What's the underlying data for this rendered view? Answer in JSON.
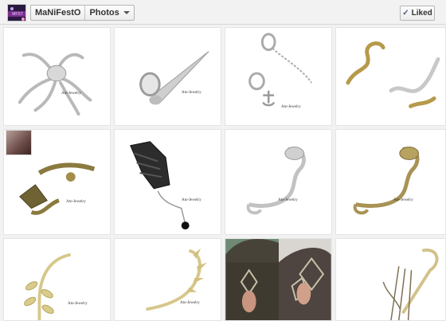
{
  "header": {
    "page_name": "MaNiFestO",
    "section_label": "Photos",
    "like_button_label": "Liked",
    "avatar_icon": "page-profile-picture"
  },
  "photos": [
    {
      "subject": "silver octopus ear cuff",
      "watermark": "Ato-Jewelry"
    },
    {
      "subject": "silver horn ear cuff",
      "watermark": "Ato-Jewelry"
    },
    {
      "subject": "silver anchor chain ear cuff",
      "watermark": "Ato-Jewelry"
    },
    {
      "subject": "gold snake ear cuffs",
      "watermark": ""
    },
    {
      "subject": "bronze dragon ear cuff",
      "watermark": "Ato-Jewelry"
    },
    {
      "subject": "black wing ear cuff with drop",
      "watermark": "Ato-Jewelry"
    },
    {
      "subject": "silver cobra ear cuff",
      "watermark": "Ato-Jewelry"
    },
    {
      "subject": "gold cobra ear cuff",
      "watermark": "Ato-Jewelry"
    },
    {
      "subject": "gold leaf ear cuff",
      "watermark": "Ato-Jewelry"
    },
    {
      "subject": "gold spike ear cuff",
      "watermark": "Ato-Jewelry"
    },
    {
      "subject": "leaf ear cuff worn photo",
      "watermark": ""
    },
    {
      "subject": "gold chain ear cuff",
      "watermark": ""
    }
  ]
}
